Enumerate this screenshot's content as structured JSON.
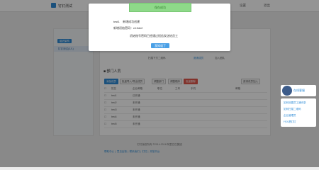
{
  "header": {
    "brand": "钉钉测试",
    "nav": [
      "首页",
      "设置",
      "退出"
    ]
  },
  "sidebar": {
    "button_label": "组织架构",
    "item_label": "钉钉测试(3人)"
  },
  "content": {
    "invite_hint": "扫描下方二维码",
    "invite_link": "邀请成员",
    "invite_text": "加入团队",
    "dept_title": "部门人员",
    "toolbar": [
      "添加成员",
      "批量导入/导出成员",
      "调整部门",
      "调整顺序",
      "批量删除"
    ],
    "invite_button": "邀请成员加入",
    "table_headers": [
      "姓名",
      "企业邮箱",
      "职位",
      "工号",
      "手机",
      "邮箱"
    ],
    "rows": [
      {
        "name": "test1",
        "email": "已开通"
      },
      {
        "name": "test2",
        "email": "未开通"
      },
      {
        "name": "test3",
        "email": "未开通"
      },
      {
        "name": "test4",
        "email": "未开通"
      },
      {
        "name": "test5",
        "email": "未开通"
      }
    ]
  },
  "footer": {
    "text": "钉钉版权所有 ©2014-2016 阿里巴巴集团",
    "links": [
      "帮助中心",
      "意见反馈",
      "联系我们",
      "钉钉",
      "开放平台"
    ]
  },
  "modal": {
    "toast": "保存成功",
    "line1": "test1",
    "line1_value": "新增成功创建",
    "line2_label": "新增初始密码：",
    "line2_value": "e13de2",
    "line3": "初始账号密码已经通过短信发送给员工",
    "button": "我知道了"
  },
  "chat": {
    "title": "在线客服",
    "items": [
      "如何设置员工通讯录",
      "如何扫描二维码",
      "企业管理员",
      "什么是钉钉"
    ]
  },
  "colors": {
    "accent": "#2d8bd6",
    "toast_bg": "#8ed989",
    "danger": "#e0564b"
  }
}
